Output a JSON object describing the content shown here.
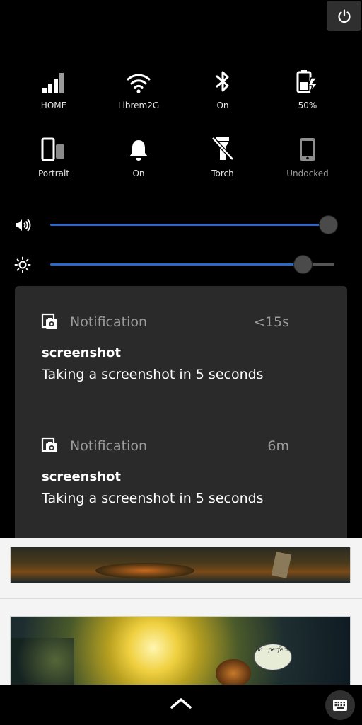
{
  "quick_settings": {
    "tiles": [
      {
        "label": "HOME",
        "icon": "cellular-signal-icon"
      },
      {
        "label": "Librem2G",
        "icon": "wifi-icon"
      },
      {
        "label": "On",
        "icon": "bluetooth-icon"
      },
      {
        "label": "50%",
        "icon": "battery-charging-icon"
      },
      {
        "label": "Portrait",
        "icon": "rotation-lock-icon"
      },
      {
        "label": "On",
        "icon": "bell-icon"
      },
      {
        "label": "Torch",
        "icon": "torch-icon"
      },
      {
        "label": "Undocked",
        "icon": "phone-dock-icon"
      }
    ],
    "volume_level": 0.98,
    "brightness_level": 0.89,
    "accent_color": "#2a67c9"
  },
  "notifications": [
    {
      "app": "Notification",
      "time": "<15s",
      "title": "screenshot",
      "body": "Taking a screenshot in 5 seconds",
      "icon": "screenshot-icon"
    },
    {
      "app": "Notification",
      "time": "6m",
      "title": "screenshot",
      "body": "Taking a screenshot in 5 seconds",
      "icon": "screenshot-icon"
    }
  ],
  "background_image": {
    "bubble_text": "ha.. perfect"
  }
}
